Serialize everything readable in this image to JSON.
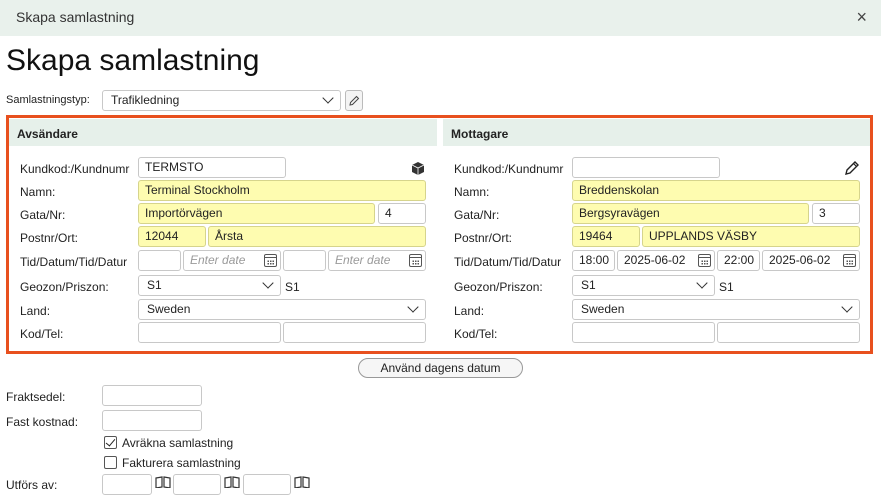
{
  "window": {
    "title": "Skapa samlastning",
    "close": "×"
  },
  "page_title": "Skapa samlastning",
  "type_row": {
    "label": "Samlastningstyp:",
    "value": "Trafikledning"
  },
  "labels": {
    "kundkod": "Kundkod:/Kundnumr",
    "namn": "Namn:",
    "gata": "Gata/Nr:",
    "postnr": "Postnr/Ort:",
    "tid": "Tid/Datum/Tid/Datur",
    "geozon": "Geozon/Priszon:",
    "land": "Land:",
    "kodtel": "Kod/Tel:"
  },
  "sender": {
    "title": "Avsändare",
    "kundkod": "TERMSTO",
    "namn": "Terminal Stockholm",
    "gata": "Importörvägen",
    "nr": "4",
    "postnr": "12044",
    "ort": "Årsta",
    "tid1": "",
    "datum1_placeholder": "Enter date",
    "tid2": "",
    "datum2_placeholder": "Enter date",
    "geozon": "S1",
    "priszon": "S1",
    "land": "Sweden",
    "kod": "",
    "tel": ""
  },
  "receiver": {
    "title": "Mottagare",
    "kundkod": "",
    "namn": "Breddenskolan",
    "gata": "Bergsyravägen",
    "nr": "3",
    "postnr": "19464",
    "ort": "UPPLANDS VÄSBY",
    "tid1": "18:00",
    "datum1": "2025-06-02",
    "tid2": "22:00",
    "datum2": "2025-06-02",
    "geozon": "S1",
    "priszon": "S1",
    "land": "Sweden",
    "kod": "",
    "tel": ""
  },
  "use_today_button": "Använd dagens datum",
  "fraktsedel": {
    "label": "Fraktsedel:",
    "value": ""
  },
  "fast_kostnad": {
    "label": "Fast kostnad:",
    "value": ""
  },
  "checkboxes": [
    {
      "label": "Avräkna samlastning",
      "checked": true
    },
    {
      "label": "Fakturera samlastning",
      "checked": false
    }
  ],
  "utfors_av": {
    "label": "Utförs av:"
  },
  "colors": {
    "highlight_border": "#e8501e",
    "required_field": "#fefcb0",
    "panel_header": "#e6f0ea"
  },
  "icons": [
    "close-icon",
    "chevron-down-icon",
    "pencil-icon",
    "cube-stack-icon",
    "calendar-icon",
    "book-icon"
  ]
}
